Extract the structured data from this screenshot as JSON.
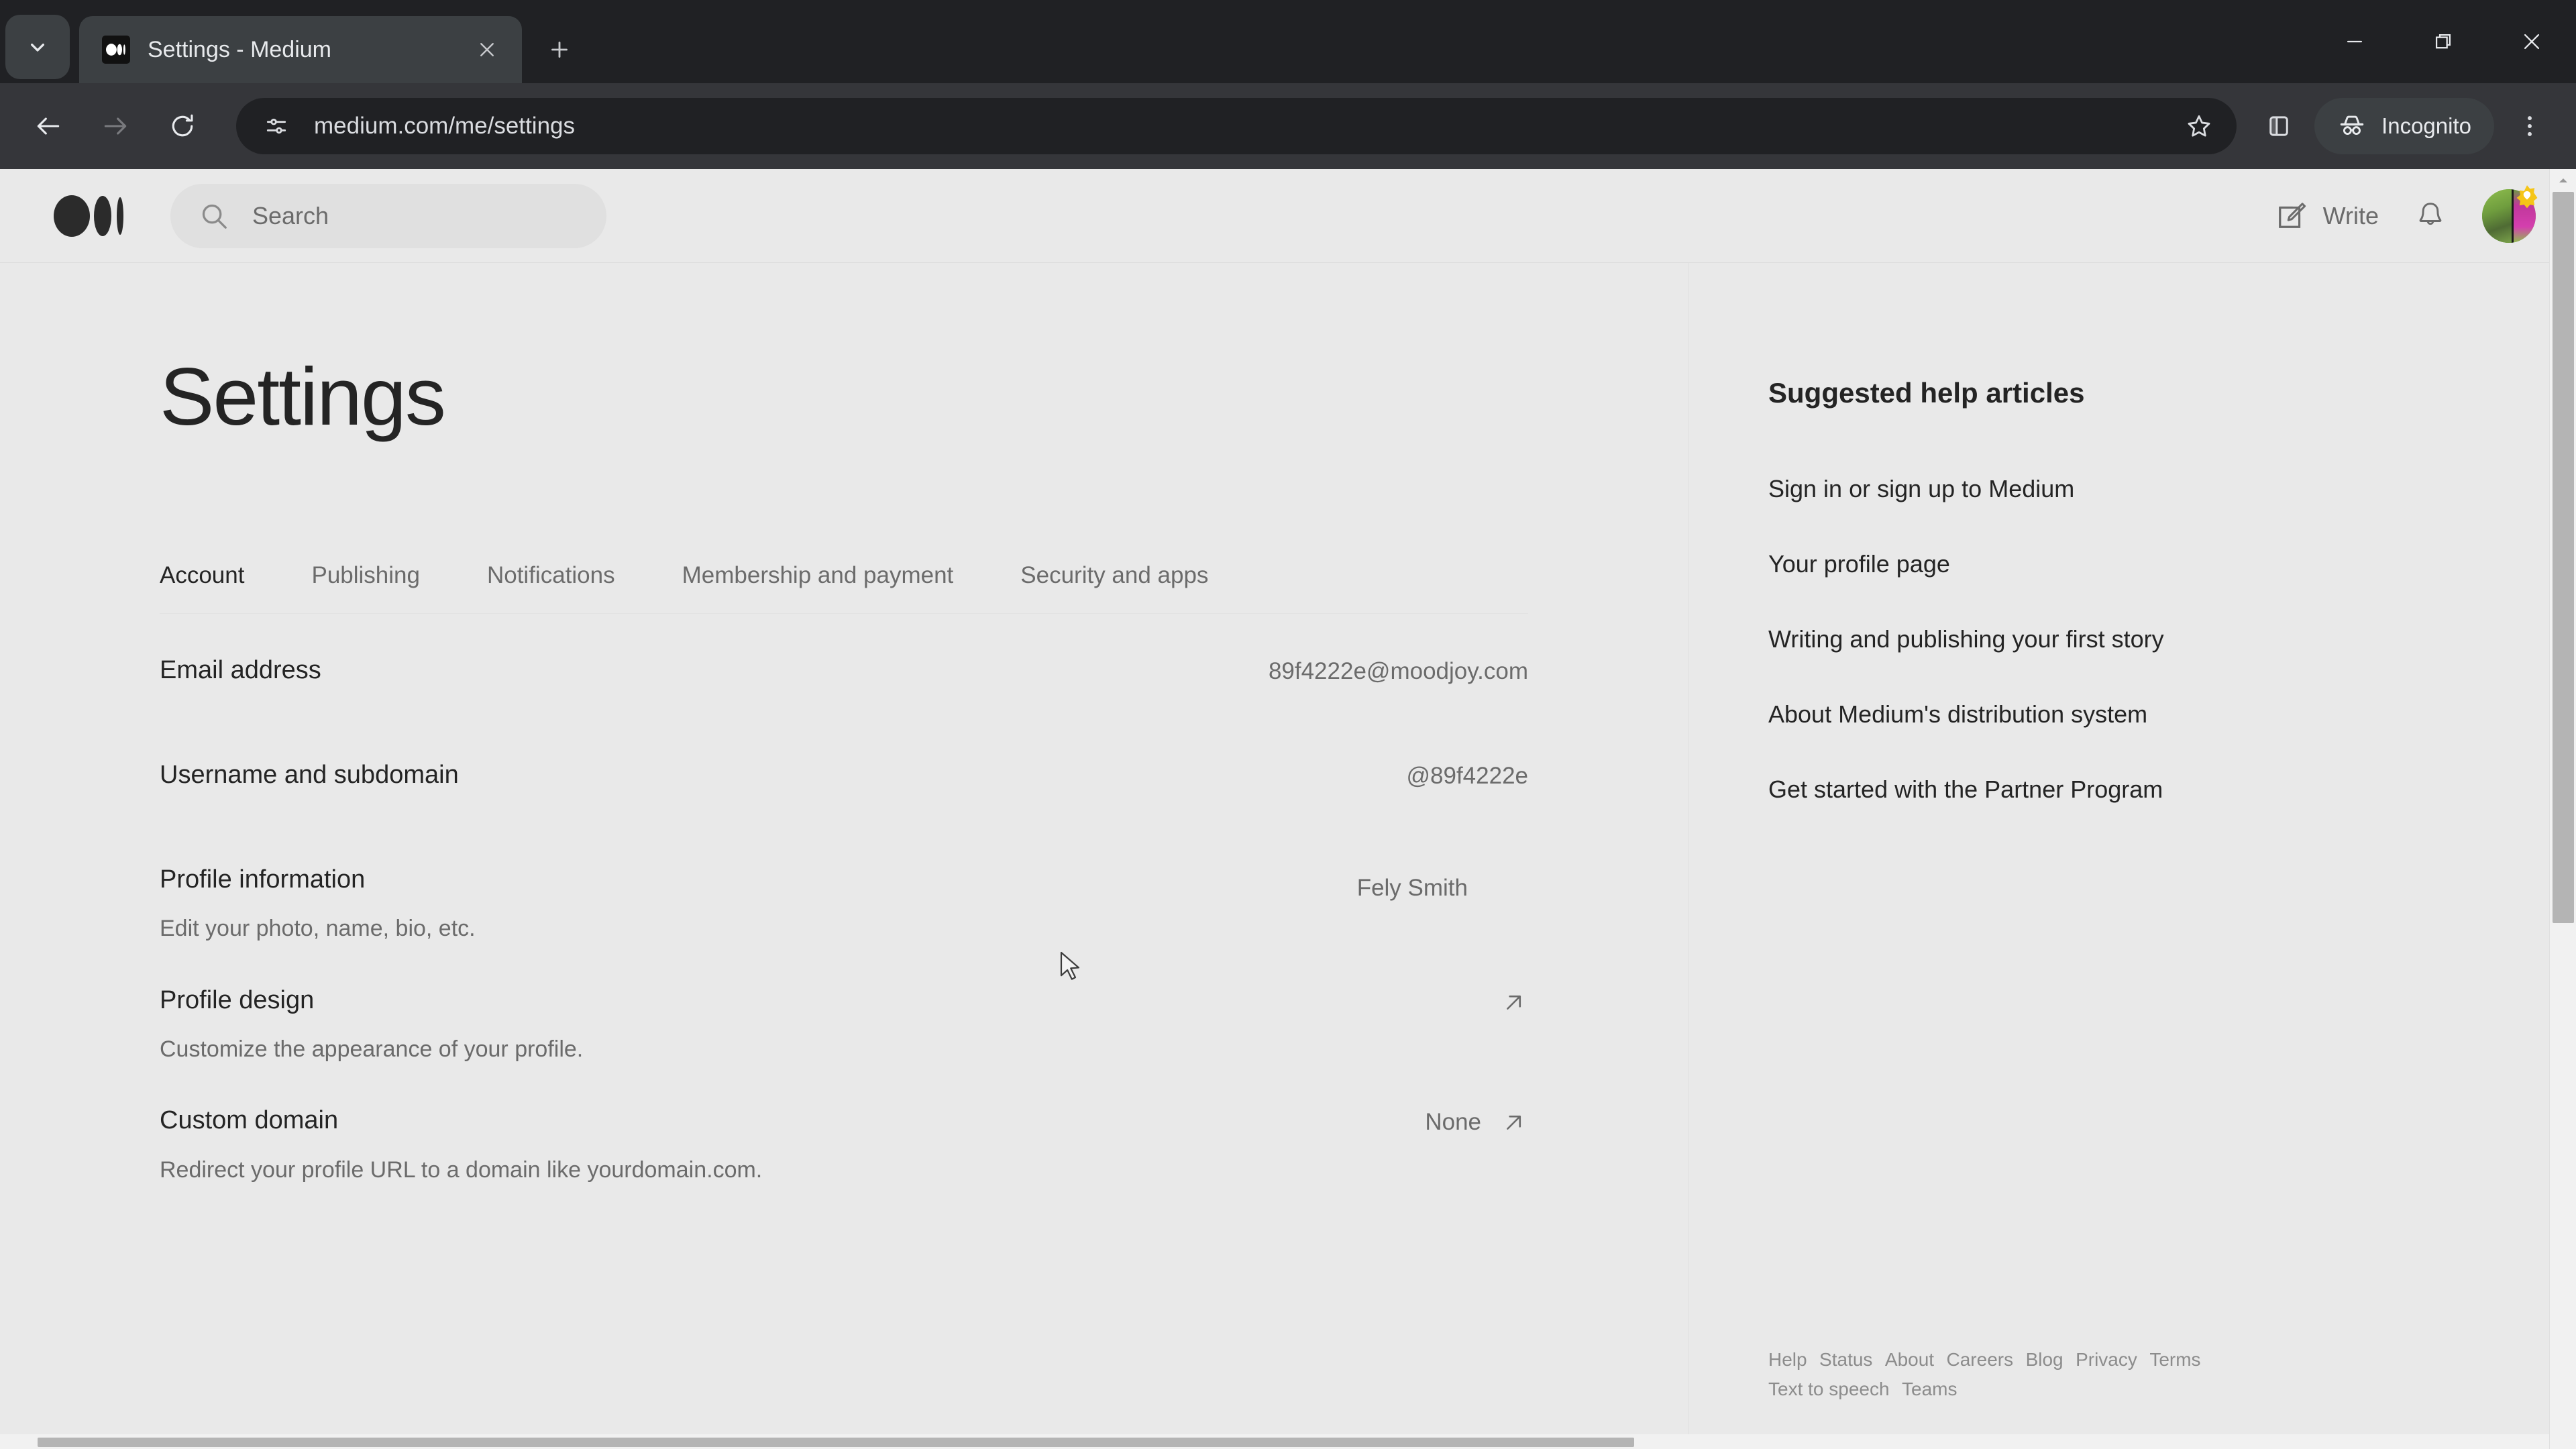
{
  "browser": {
    "tab": {
      "title": "Settings - Medium",
      "favicon_name": "medium-favicon"
    },
    "new_tab_label": "+",
    "omnibox": {
      "url": "medium.com/me/settings",
      "site_info_icon": "tune-icon",
      "bookmark_icon": "star-icon"
    },
    "profile_label": "Incognito",
    "window_controls": {
      "minimize": "minimize-icon",
      "maximize": "restore-icon",
      "close": "close-icon"
    }
  },
  "site_header": {
    "logo_name": "medium-logo",
    "search": {
      "placeholder": "Search"
    },
    "write_label": "Write",
    "notifications_icon": "bell-icon",
    "avatar_name": "user-avatar"
  },
  "main": {
    "title": "Settings",
    "tabs": [
      {
        "label": "Account",
        "active": true
      },
      {
        "label": "Publishing",
        "active": false
      },
      {
        "label": "Notifications",
        "active": false
      },
      {
        "label": "Membership and payment",
        "active": false
      },
      {
        "label": "Security and apps",
        "active": false
      }
    ],
    "rows": [
      {
        "label": "Email address",
        "desc": "",
        "value": "89f4222e@moodjoy.com",
        "has_avatar": false,
        "has_arrow": false
      },
      {
        "label": "Username and subdomain",
        "desc": "",
        "value": "@89f4222e",
        "has_avatar": false,
        "has_arrow": false
      },
      {
        "label": "Profile information",
        "desc": "Edit your photo, name, bio, etc.",
        "value": "Fely Smith",
        "has_avatar": true,
        "has_arrow": false
      },
      {
        "label": "Profile design",
        "desc": "Customize the appearance of your profile.",
        "value": "",
        "has_avatar": false,
        "has_arrow": true
      },
      {
        "label": "Custom domain",
        "desc": "Redirect your profile URL to a domain like yourdomain.com.",
        "value": "None",
        "has_avatar": false,
        "has_arrow": true
      }
    ]
  },
  "rail": {
    "title": "Suggested help articles",
    "links": [
      "Sign in or sign up to Medium",
      "Your profile page",
      "Writing and publishing your first story",
      "About Medium's distribution system",
      "Get started with the Partner Program"
    ],
    "footer_links": [
      "Help",
      "Status",
      "About",
      "Careers",
      "Blog",
      "Privacy",
      "Terms",
      "Text to speech",
      "Teams"
    ]
  },
  "colors": {
    "page_bg": "#e9e9e9",
    "text_primary": "#242424",
    "text_secondary": "#6b6b6b",
    "chrome_bg": "#202124",
    "toolbar_bg": "#35363a"
  }
}
